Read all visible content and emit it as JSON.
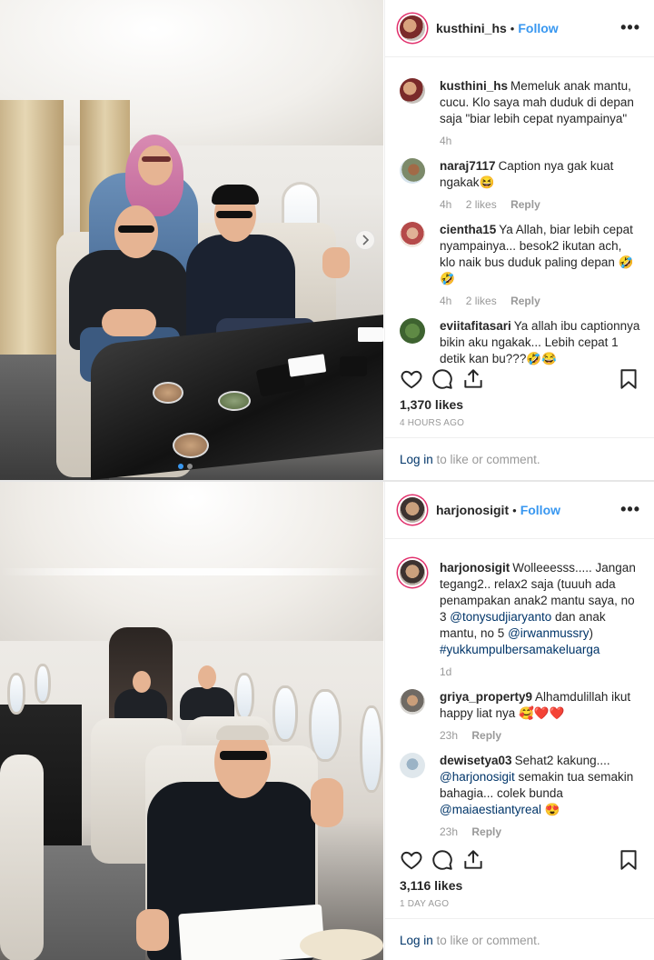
{
  "post1": {
    "header": {
      "username": "kusthini_hs",
      "bullet": "•",
      "follow": "Follow",
      "more": "•••"
    },
    "caption": {
      "username": "kusthini_hs",
      "text": "Memeluk anak mantu, cucu. Klo saya mah duduk di depan saja \"biar lebih cepat nyampainya\"",
      "time": "4h"
    },
    "comments": [
      {
        "username": "naraj7117",
        "text": "Caption nya gak kuat ngakak😆",
        "time": "4h",
        "likes": "2 likes",
        "reply": "Reply"
      },
      {
        "username": "cientha15",
        "text": "Ya Allah, biar lebih cepat nyampainya... besok2 ikutan ach, klo naik bus duduk paling depan 🤣🤣",
        "time": "4h",
        "likes": "2 likes",
        "reply": "Reply"
      },
      {
        "username": "eviitafitasari",
        "text": "Ya allah ibu captionnya bikin aku ngakak... Lebih cepat 1 detik kan bu???🤣😂"
      }
    ],
    "likes": "1,370 likes",
    "ago": "4 HOURS AGO",
    "login": {
      "link": "Log in",
      "rest": " to like or comment."
    }
  },
  "post2": {
    "header": {
      "username": "harjonosigit",
      "bullet": "•",
      "follow": "Follow",
      "more": "•••"
    },
    "caption": {
      "username": "harjonosigit",
      "text1": "Wolleeesss..... Jangan tegang2.. relax2 saja (tuuuh ada penampakan anak2 mantu saya, no 3 ",
      "mention1": "@tonysudjiaryanto",
      "text2": " dan anak mantu, no 5 ",
      "mention2": "@irwanmussry",
      "text3": ") ",
      "hashtag": "#yukkumpulbersamakeluarga",
      "time": "1d"
    },
    "comments": [
      {
        "username": "griya_property9",
        "text": "Alhamdulillah ikut happy liat nya 🥰❤️❤️",
        "time": "23h",
        "reply": "Reply"
      },
      {
        "username": "dewisetya03",
        "text1": "Sehat2 kakung.... ",
        "mention1": "@harjonosigit",
        "text2": " semakin tua semakin bahagia... colek bunda ",
        "mention2": "@maiaestiantyreal",
        "text3": " 😍",
        "time": "23h",
        "reply": "Reply"
      }
    ],
    "likes": "3,116 likes",
    "ago": "1 DAY AGO",
    "login": {
      "link": "Log in",
      "rest": " to like or comment."
    }
  },
  "icons": [
    "heart-icon",
    "comment-icon",
    "share-icon",
    "bookmark-icon",
    "more-icon",
    "chevron-right-icon"
  ],
  "colors": {
    "link_blue": "#3897f0",
    "mention": "#003569",
    "muted": "#999999",
    "text": "#262626"
  }
}
